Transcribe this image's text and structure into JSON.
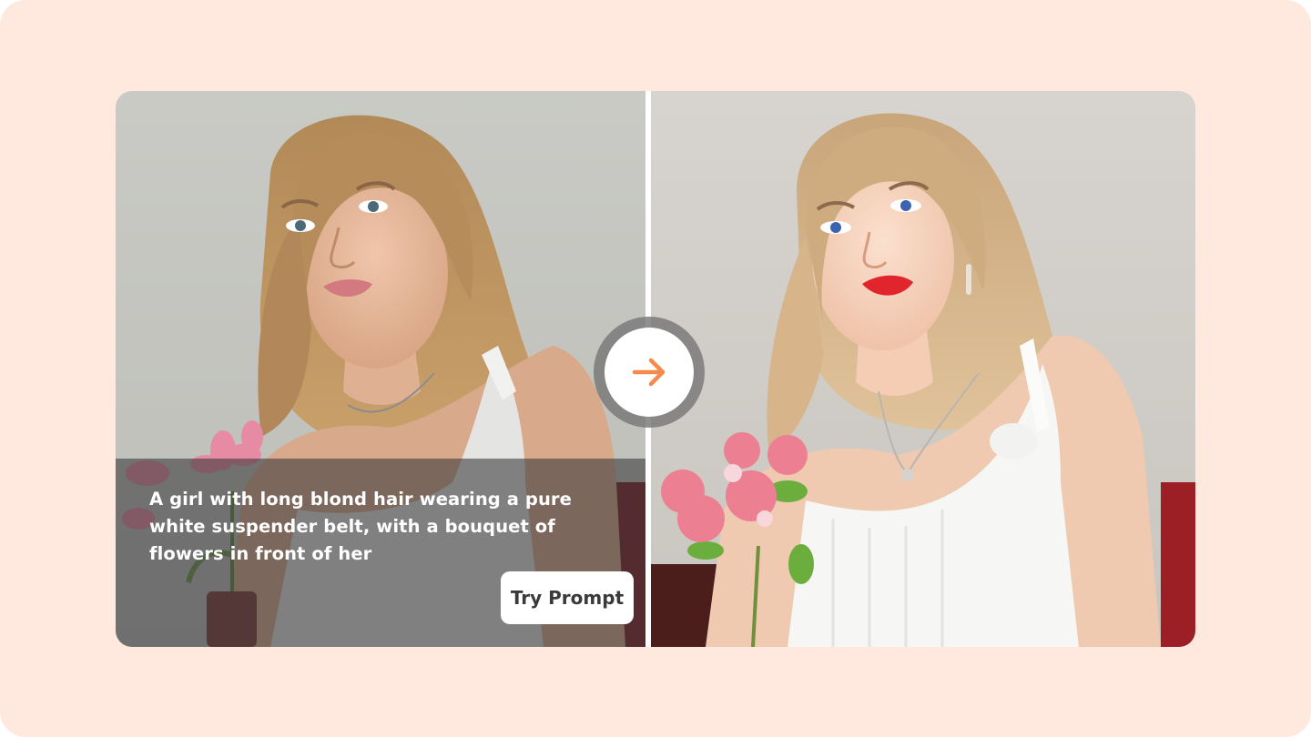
{
  "comparison": {
    "before_image_icon": "photo-portrait",
    "after_image_icon": "photo-portrait-enhanced",
    "divider_icon": "arrow-right-icon",
    "prompt_text": "A girl with long blond hair wearing a pure white suspender belt, with a bouquet of flowers in front of her",
    "try_button_label": "Try Prompt"
  },
  "colors": {
    "background": "#ffe9df",
    "accent": "#f58a4c",
    "overlay": "#37373a",
    "button_text": "#3a3a3a"
  }
}
